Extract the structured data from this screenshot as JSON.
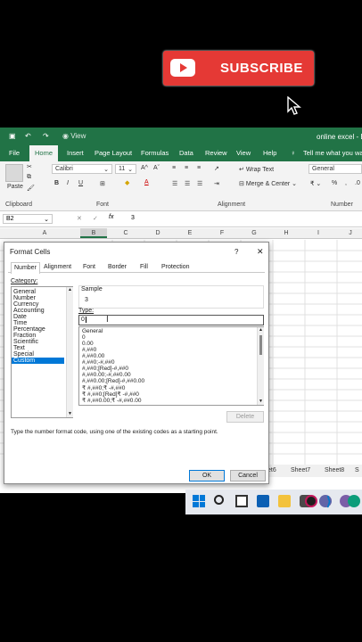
{
  "subscribe": {
    "label": "SUBSCRIBE"
  },
  "excel": {
    "title": "online excel - Ex",
    "view_label": "View",
    "tabs": [
      "File",
      "Home",
      "Insert",
      "Page Layout",
      "Formulas",
      "Data",
      "Review",
      "View",
      "Help"
    ],
    "tell_me": "Tell me what you wan",
    "ribbon": {
      "paste": "Paste",
      "font_name": "Calibri",
      "font_size": "11",
      "wrap_text": "Wrap Text",
      "merge_center": "Merge & Center",
      "number_format": "General",
      "groups": {
        "clipboard": "Clipboard",
        "font": "Font",
        "alignment": "Alignment",
        "number": "Number"
      }
    },
    "name_box": "B2",
    "formula_value": "3",
    "columns": [
      "A",
      "B",
      "C",
      "D",
      "E",
      "F",
      "G",
      "H",
      "I",
      "J"
    ],
    "sheet_tabs": [
      "et6",
      "Sheet7",
      "Sheet8",
      "S"
    ]
  },
  "dialog": {
    "title": "Format Cells",
    "help": "?",
    "close": "✕",
    "tabs": [
      "Number",
      "Alignment",
      "Font",
      "Border",
      "Fill",
      "Protection"
    ],
    "category_label": "Category:",
    "categories": [
      "General",
      "Number",
      "Currency",
      "Accounting",
      "Date",
      "Time",
      "Percentage",
      "Fraction",
      "Scientific",
      "Text",
      "Special",
      "Custom"
    ],
    "selected_category": "Custom",
    "sample_label": "Sample",
    "sample_value": "3",
    "type_label": "Type:",
    "type_value": "0",
    "formats": [
      "General",
      "0",
      "0.00",
      "#,##0",
      "#,##0.00",
      "#,##0;-#,##0",
      "#,##0;[Red]-#,##0",
      "#,##0.00;-#,##0.00",
      "#,##0.00;[Red]-#,##0.00",
      "₹ #,##0;₹ -#,##0",
      "₹ #,##0;[Red]₹ -#,##0",
      "₹ #,##0.00;₹ -#,##0.00"
    ],
    "delete_label": "Delete",
    "hint": "Type the number format code, using one of the existing codes as a starting point.",
    "ok_label": "OK",
    "cancel_label": "Cancel"
  },
  "taskbar": {
    "icons": [
      "windows-start-icon",
      "search-icon",
      "file-explorer-icon",
      "task-view-icon",
      "store-icon",
      "camera-icon",
      "teams-chat-icon",
      "media-icon",
      "vscode-icon",
      "edge-icon"
    ]
  }
}
